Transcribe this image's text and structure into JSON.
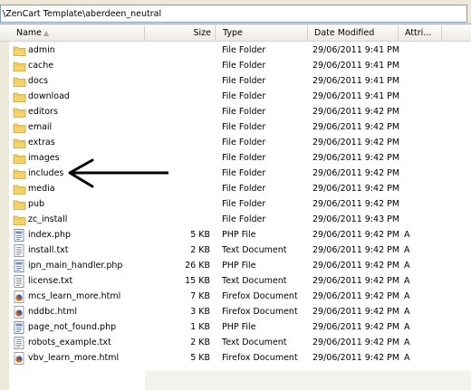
{
  "address": {
    "path": "\\ZenCart Template\\aberdeen_neutral"
  },
  "columns": {
    "name": "Name",
    "size": "Size",
    "type": "Type",
    "date": "Date Modified",
    "attr": "Attri..."
  },
  "files": [
    {
      "name": "admin",
      "size": "",
      "type": "File Folder",
      "date": "29/06/2011 9:41 PM",
      "attr": "",
      "icon": "folder-icon"
    },
    {
      "name": "cache",
      "size": "",
      "type": "File Folder",
      "date": "29/06/2011 9:41 PM",
      "attr": "",
      "icon": "folder-icon"
    },
    {
      "name": "docs",
      "size": "",
      "type": "File Folder",
      "date": "29/06/2011 9:41 PM",
      "attr": "",
      "icon": "folder-icon"
    },
    {
      "name": "download",
      "size": "",
      "type": "File Folder",
      "date": "29/06/2011 9:41 PM",
      "attr": "",
      "icon": "folder-icon"
    },
    {
      "name": "editors",
      "size": "",
      "type": "File Folder",
      "date": "29/06/2011 9:42 PM",
      "attr": "",
      "icon": "folder-icon"
    },
    {
      "name": "email",
      "size": "",
      "type": "File Folder",
      "date": "29/06/2011 9:42 PM",
      "attr": "",
      "icon": "folder-icon"
    },
    {
      "name": "extras",
      "size": "",
      "type": "File Folder",
      "date": "29/06/2011 9:42 PM",
      "attr": "",
      "icon": "folder-icon"
    },
    {
      "name": "images",
      "size": "",
      "type": "File Folder",
      "date": "29/06/2011 9:42 PM",
      "attr": "",
      "icon": "folder-icon"
    },
    {
      "name": "includes",
      "size": "",
      "type": "File Folder",
      "date": "29/06/2011 9:42 PM",
      "attr": "",
      "icon": "folder-icon"
    },
    {
      "name": "media",
      "size": "",
      "type": "File Folder",
      "date": "29/06/2011 9:42 PM",
      "attr": "",
      "icon": "folder-icon"
    },
    {
      "name": "pub",
      "size": "",
      "type": "File Folder",
      "date": "29/06/2011 9:42 PM",
      "attr": "",
      "icon": "folder-icon"
    },
    {
      "name": "zc_install",
      "size": "",
      "type": "File Folder",
      "date": "29/06/2011 9:43 PM",
      "attr": "",
      "icon": "folder-icon"
    },
    {
      "name": "index.php",
      "size": "5 KB",
      "type": "PHP File",
      "date": "29/06/2011 9:42 PM",
      "attr": "A",
      "icon": "php-file-icon"
    },
    {
      "name": "install.txt",
      "size": "2 KB",
      "type": "Text Document",
      "date": "29/06/2011 9:42 PM",
      "attr": "A",
      "icon": "text-file-icon"
    },
    {
      "name": "ipn_main_handler.php",
      "size": "26 KB",
      "type": "PHP File",
      "date": "29/06/2011 9:42 PM",
      "attr": "A",
      "icon": "php-file-icon"
    },
    {
      "name": "license.txt",
      "size": "15 KB",
      "type": "Text Document",
      "date": "29/06/2011 9:42 PM",
      "attr": "A",
      "icon": "text-file-icon"
    },
    {
      "name": "mcs_learn_more.html",
      "size": "7 KB",
      "type": "Firefox Document",
      "date": "29/06/2011 9:42 PM",
      "attr": "A",
      "icon": "firefox-document-icon"
    },
    {
      "name": "nddbc.html",
      "size": "3 KB",
      "type": "Firefox Document",
      "date": "29/06/2011 9:42 PM",
      "attr": "A",
      "icon": "firefox-document-icon"
    },
    {
      "name": "page_not_found.php",
      "size": "1 KB",
      "type": "PHP File",
      "date": "29/06/2011 9:42 PM",
      "attr": "A",
      "icon": "php-file-icon"
    },
    {
      "name": "robots_example.txt",
      "size": "2 KB",
      "type": "Text Document",
      "date": "29/06/2011 9:42 PM",
      "attr": "A",
      "icon": "text-file-icon"
    },
    {
      "name": "vbv_learn_more.html",
      "size": "5 KB",
      "type": "Firefox Document",
      "date": "29/06/2011 9:42 PM",
      "attr": "A",
      "icon": "firefox-document-icon"
    }
  ],
  "annotation": {
    "points_to": "includes"
  },
  "colors": {
    "folder": "#f3d36a",
    "folder_edge": "#c9a22a",
    "firefox_orange": "#e66000",
    "firefox_blue": "#3a5ca8",
    "header_border": "#d5d2c6"
  }
}
